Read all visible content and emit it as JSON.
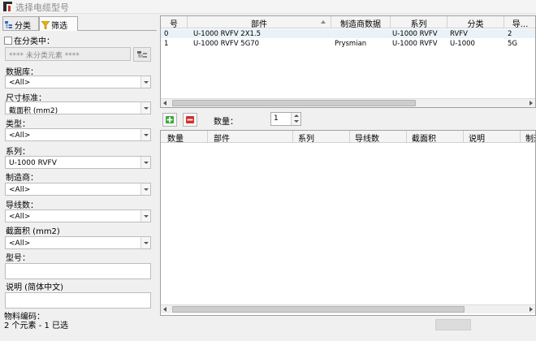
{
  "window": {
    "title": "选择电缆型号"
  },
  "left_panel": {
    "tabs": [
      {
        "label": "分类",
        "icon": "hierarchy-icon"
      },
      {
        "label": "筛选",
        "icon": "funnel-icon"
      }
    ],
    "in_category_label": "在分类中：",
    "unclassified_text": "**** 未分类元素 ****",
    "filters": [
      {
        "label": "数据库：",
        "value": "<All>"
      },
      {
        "label": "尺寸标准：",
        "value": "截面积 (mm2)"
      },
      {
        "label": "类型：",
        "value": "<All>"
      },
      {
        "label": "系列：",
        "value": "U-1000 RVFV"
      },
      {
        "label": "制造商：",
        "value": "<All>"
      },
      {
        "label": "导线数：",
        "value": "<All>"
      },
      {
        "label": "截面积 (mm2)",
        "value": "<All>"
      }
    ],
    "model_label": "型号：",
    "model_value": "",
    "desc_label": "说明 (简体中文)",
    "desc_value": "",
    "material_label": "物料编码：",
    "status": "2 个元素 - 1 已选"
  },
  "cable_table": {
    "columns": [
      "号",
      "部件",
      "制造商数据",
      "系列",
      "分类",
      "导..."
    ],
    "rows": [
      {
        "no": "0",
        "part": "U-1000 RVFV 2X1.5",
        "mfr": "",
        "series": "U-1000 RVFV",
        "category": "RVFV",
        "conductors": "2"
      },
      {
        "no": "1",
        "part": "U-1000 RVFV 5G70",
        "mfr": "Prysmian",
        "series": "U-1000 RVFV",
        "category": "U-1000",
        "conductors": "5G"
      }
    ]
  },
  "toolbar": {
    "add_icon": "add-icon",
    "remove_icon": "remove-icon",
    "quantity_label": "数量：",
    "quantity_value": "1"
  },
  "selected_table": {
    "columns": [
      "数量",
      "部件",
      "系列",
      "导线数",
      "截面积",
      "说明",
      "制造"
    ]
  },
  "colors": {
    "add": "#3aa83a",
    "remove": "#d23030",
    "selected_row": "#eaf2f8"
  }
}
